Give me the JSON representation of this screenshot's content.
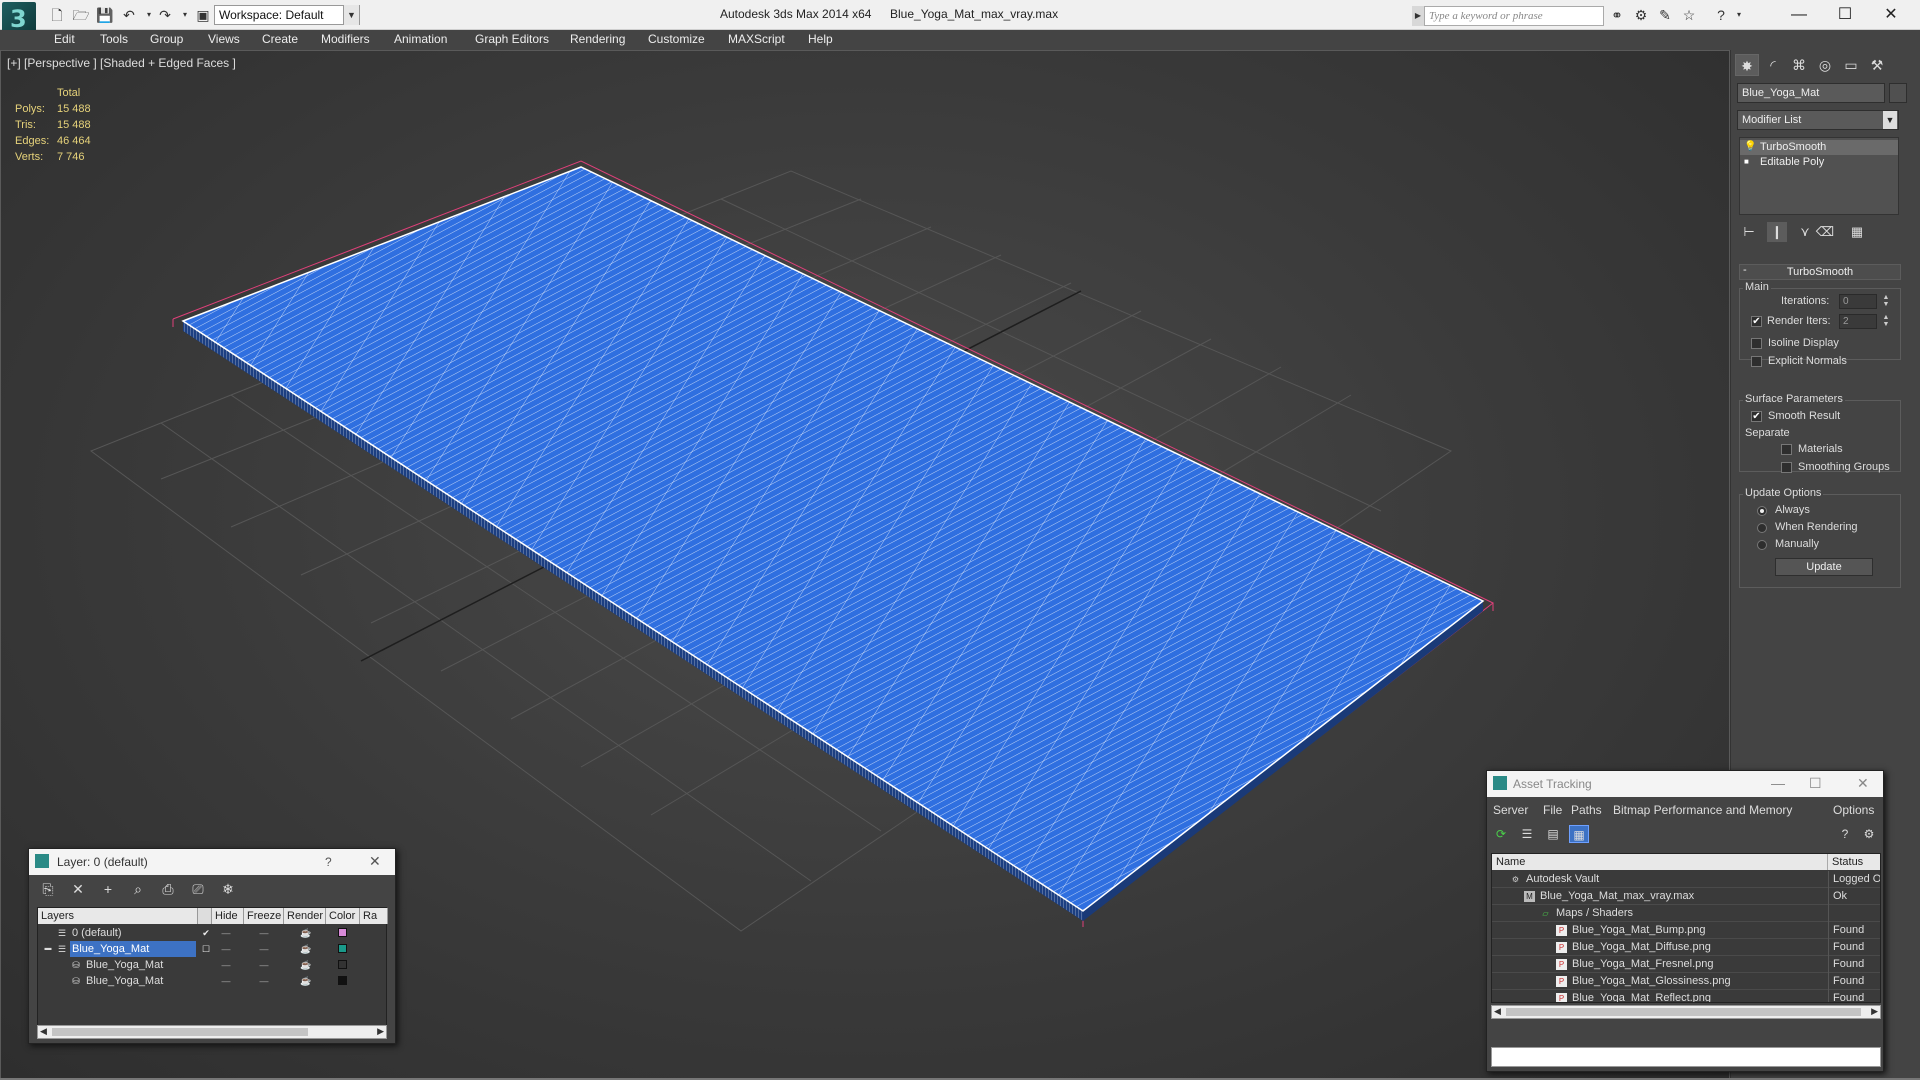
{
  "titlebar": {
    "app_title": "Autodesk 3ds Max  2014 x64",
    "file_title": "Blue_Yoga_Mat_max_vray.max",
    "workspace": "Workspace: Default",
    "search_placeholder": "Type a keyword or phrase",
    "minimize": "—",
    "maximize": "☐",
    "close": "✕"
  },
  "menu": [
    "Edit",
    "Tools",
    "Group",
    "Views",
    "Create",
    "Modifiers",
    "Animation",
    "Graph Editors",
    "Rendering",
    "Customize",
    "MAXScript",
    "Help"
  ],
  "viewport": {
    "label": "[+] [Perspective ] [Shaded + Edged Faces ]",
    "stats": {
      "header": "Total",
      "rows": [
        {
          "label": "Polys:",
          "value": "15 488"
        },
        {
          "label": "Tris:",
          "value": "15 488"
        },
        {
          "label": "Edges:",
          "value": "46 464"
        },
        {
          "label": "Verts:",
          "value": "7 746"
        }
      ]
    },
    "colors": {
      "mat_fill": "#2f6fe0",
      "wire": "#ffffff",
      "selection": "#e0407a",
      "grid": "#555555"
    }
  },
  "command_panel": {
    "object_name": "Blue_Yoga_Mat",
    "modifier_list": "Modifier List",
    "stack": [
      "TurboSmooth",
      "Editable Poly"
    ],
    "rollout_title": "TurboSmooth",
    "main_group": "Main",
    "iterations_label": "Iterations:",
    "iterations_value": "0",
    "render_iters_label": "Render Iters:",
    "render_iters_value": "2",
    "render_iters_checked": true,
    "isoline_label": "Isoline Display",
    "isoline_checked": false,
    "explicit_label": "Explicit Normals",
    "explicit_checked": false,
    "surface_group": "Surface Parameters",
    "smooth_result_label": "Smooth Result",
    "smooth_result_checked": true,
    "separate_label": "Separate",
    "materials_label": "Materials",
    "smoothing_groups_label": "Smoothing Groups",
    "update_group": "Update Options",
    "always_label": "Always",
    "when_rendering_label": "When Rendering",
    "manually_label": "Manually",
    "update_button": "Update"
  },
  "layer_panel": {
    "title": "Layer: 0 (default)",
    "help": "?",
    "close": "✕",
    "columns": [
      "Layers",
      "Hide",
      "Freeze",
      "Render",
      "Color",
      "Ra"
    ],
    "rows": [
      {
        "name": "0 (default)",
        "color": "#d88ad8",
        "active": true,
        "selected": false,
        "indent": 0
      },
      {
        "name": "Blue_Yoga_Mat",
        "color": "#1a9a8a",
        "active": false,
        "selected": true,
        "indent": 0
      },
      {
        "name": "Blue_Yoga_Mat",
        "color": "#333333",
        "active": false,
        "selected": false,
        "indent": 1
      },
      {
        "name": "Blue_Yoga_Mat",
        "color": "#111111",
        "active": false,
        "selected": false,
        "indent": 1
      }
    ]
  },
  "asset_tracking": {
    "title": "Asset Tracking",
    "menus": [
      "Server",
      "File",
      "Paths",
      "Bitmap Performance and Memory",
      "Options"
    ],
    "columns": [
      "Name",
      "Status"
    ],
    "rows": [
      {
        "name": "Autodesk Vault",
        "status": "Logged O",
        "indent": 0,
        "icon": "vault"
      },
      {
        "name": "Blue_Yoga_Mat_max_vray.max",
        "status": "Ok",
        "indent": 1,
        "icon": "max"
      },
      {
        "name": "Maps / Shaders",
        "status": "",
        "indent": 2,
        "icon": "folder"
      },
      {
        "name": "Blue_Yoga_Mat_Bump.png",
        "status": "Found",
        "indent": 3,
        "icon": "png"
      },
      {
        "name": "Blue_Yoga_Mat_Diffuse.png",
        "status": "Found",
        "indent": 3,
        "icon": "png"
      },
      {
        "name": "Blue_Yoga_Mat_Fresnel.png",
        "status": "Found",
        "indent": 3,
        "icon": "png"
      },
      {
        "name": "Blue_Yoga_Mat_Glossiness.png",
        "status": "Found",
        "indent": 3,
        "icon": "png"
      },
      {
        "name": "Blue_Yoga_Mat_Reflect.png",
        "status": "Found",
        "indent": 3,
        "icon": "png"
      }
    ]
  }
}
